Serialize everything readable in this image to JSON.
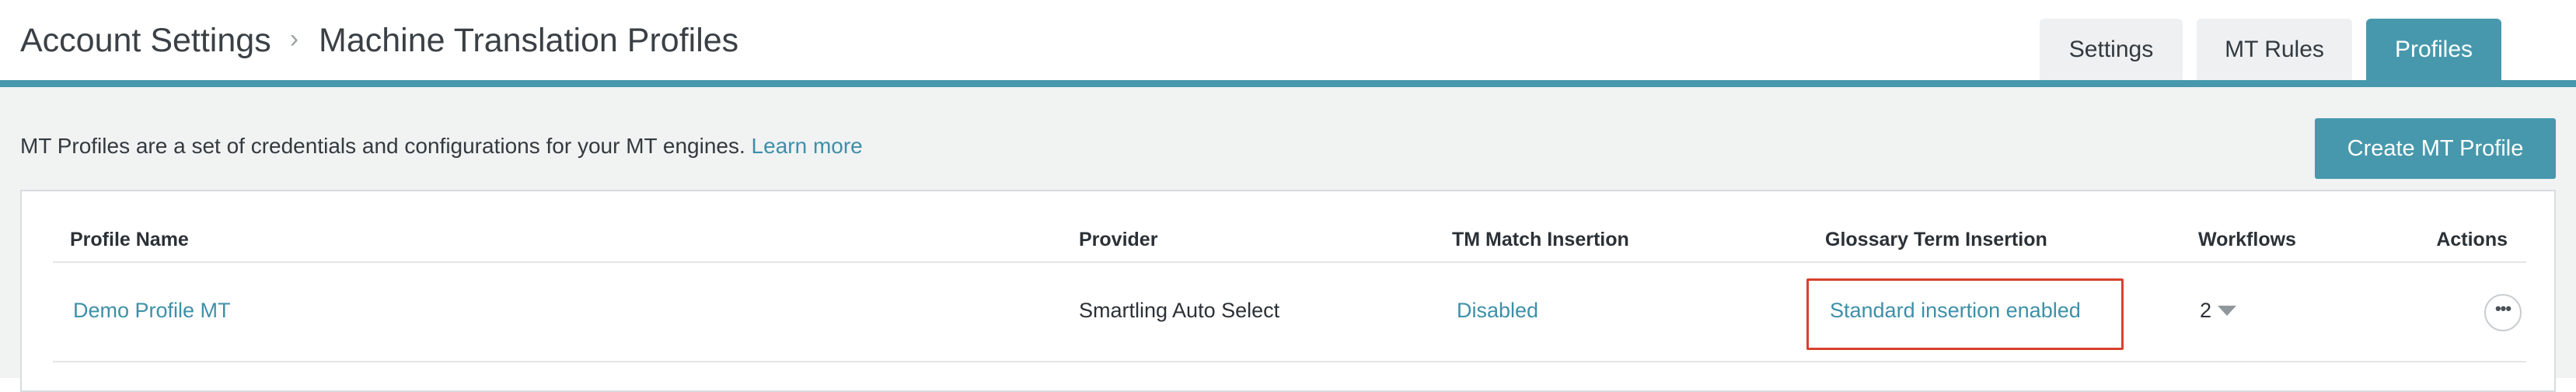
{
  "breadcrumb": {
    "parent": "Account Settings",
    "separator": "›",
    "current": "Machine Translation Profiles"
  },
  "tabs": [
    {
      "label": "Settings",
      "active": false
    },
    {
      "label": "MT Rules",
      "active": false
    },
    {
      "label": "Profiles",
      "active": true
    }
  ],
  "intro": {
    "text": "MT Profiles are a set of credentials and configurations for your MT engines.",
    "link": "Learn more"
  },
  "create_button": "Create MT Profile",
  "table": {
    "headers": {
      "profile_name": "Profile Name",
      "provider": "Provider",
      "tm_match": "TM Match Insertion",
      "glossary": "Glossary Term Insertion",
      "workflows": "Workflows",
      "actions": "Actions"
    },
    "rows": [
      {
        "profile_name": "Demo Profile MT",
        "provider": "Smartling Auto Select",
        "tm_match": "Disabled",
        "glossary": "Standard insertion enabled",
        "workflows": "2",
        "actions_icon": "more-horizontal-icon"
      }
    ]
  },
  "colors": {
    "accent": "#4798ac",
    "link": "#3d90a8",
    "highlight": "#d9412e",
    "background": "#f1f2f2"
  }
}
